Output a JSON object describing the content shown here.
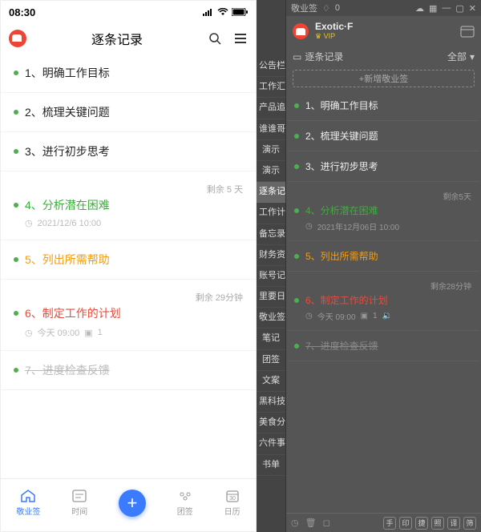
{
  "mobile": {
    "status_time": "08:30",
    "header_title": "逐条记录",
    "items": [
      {
        "title": "1、明确工作目标",
        "color": "",
        "remain": "",
        "meta": ""
      },
      {
        "title": "2、梳理关键问题",
        "color": "",
        "remain": "",
        "meta": ""
      },
      {
        "title": "3、进行初步思考",
        "color": "",
        "remain": "",
        "meta": ""
      },
      {
        "title": "4、分析潜在困难",
        "color": "green",
        "remain": "剩余 5 天",
        "meta": "2021/12/6 10:00"
      },
      {
        "title": "5、列出所需帮助",
        "color": "orange",
        "remain": "",
        "meta": ""
      },
      {
        "title": "6、制定工作的计划",
        "color": "red",
        "remain": "剩余 29分钟",
        "meta": "今天 09:00",
        "has_extra": true
      },
      {
        "title": "7、进度检查反馈",
        "color": "struck",
        "remain": "",
        "meta": ""
      }
    ],
    "tabs": {
      "home": "敬业签",
      "time": "时间",
      "team": "团签",
      "calendar": "日历"
    }
  },
  "sidebar": {
    "items": [
      "公告栏",
      "工作汇",
      "产品追",
      "谁谁哥",
      "演示",
      "演示",
      "逐条记录",
      "工作计",
      "备忘录",
      "财务资",
      "账号记",
      "里要日",
      "敬业签",
      "笔记",
      "团签",
      "文案",
      "黑科技",
      "美食分",
      "六件事",
      "书单"
    ]
  },
  "desktop": {
    "app_name": "敬业签",
    "notif": "0",
    "user_name": "Exotic·F",
    "vip": "VIP",
    "sub_title": "逐条记录",
    "sub_all": "全部",
    "add_label": "+新增敬业签",
    "items": [
      {
        "title": "1、明确工作目标",
        "color": "",
        "remain": "",
        "meta": ""
      },
      {
        "title": "2、梳理关键问题",
        "color": "",
        "remain": "",
        "meta": ""
      },
      {
        "title": "3、进行初步思考",
        "color": "",
        "remain": "",
        "meta": ""
      },
      {
        "title": "4、分析潜在困难",
        "color": "green",
        "remain": "剩余5天",
        "meta": "2021年12月06日 10:00"
      },
      {
        "title": "5、列出所需帮助",
        "color": "orange",
        "remain": "",
        "meta": ""
      },
      {
        "title": "6、制定工作的计划",
        "color": "red",
        "remain": "剩余28分钟",
        "meta": "今天 09:00",
        "has_extra": true
      },
      {
        "title": "7、进度检查反馈",
        "color": "struck",
        "remain": "",
        "meta": ""
      }
    ],
    "footer_btns": [
      "手",
      "印",
      "捷",
      "照",
      "译",
      "筛"
    ]
  }
}
